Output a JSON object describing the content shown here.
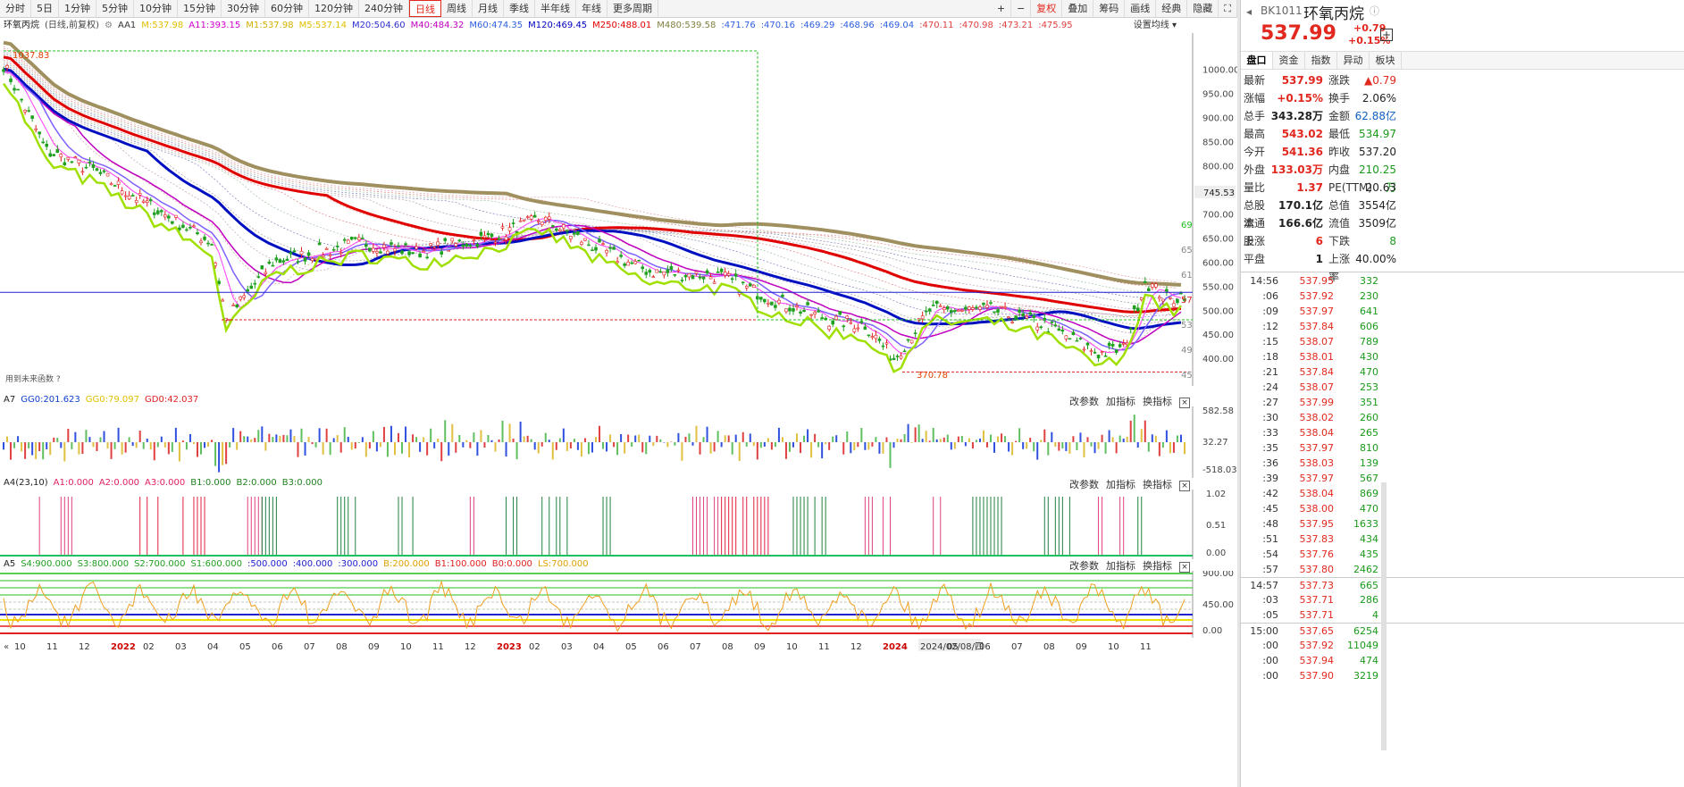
{
  "periods": [
    "分时",
    "5日",
    "1分钟",
    "5分钟",
    "10分钟",
    "15分钟",
    "30分钟",
    "60分钟",
    "120分钟",
    "240分钟",
    "日线",
    "周线",
    "月线",
    "季线",
    "半年线",
    "年线",
    "更多周期"
  ],
  "active_period": "日线",
  "tools": [
    "+",
    "−",
    "复权",
    "叠加",
    "筹码",
    "画线",
    "经典",
    "隐藏"
  ],
  "legend": {
    "name": "环氧丙烷",
    "mode": "(日线,前复权)",
    "items": [
      "AA1",
      "M:537.98",
      "A11:393.15",
      "M1:537.98",
      "M5:537.14",
      "M20:504.60",
      "M40:484.32",
      "M60:474.35",
      "M120:469.45",
      "M250:488.01",
      "M480:539.58",
      ":471.76",
      ":470.16",
      ":469.29",
      ":468.96",
      ":469.04",
      ":470.11",
      ":470.98",
      ":473.21",
      ":475.95"
    ],
    "settings": "设置均线"
  },
  "legend_colors": [
    "#333",
    "#e0c000",
    "#d000d0",
    "#d0b000",
    "#e0c000",
    "#3030d0",
    "#c000c0",
    "#3060e0",
    "#0000c0",
    "#e00000",
    "#808040",
    "#3060e0",
    "#3060e0",
    "#3060e0",
    "#3060e0",
    "#3060e0",
    "#e04040",
    "#e04040",
    "#e04040",
    "#e04040"
  ],
  "main": {
    "price_axis": [
      "1000.00",
      "950.00",
      "900.00",
      "850.00",
      "800.00",
      "750.00",
      "700.00",
      "650.00",
      "600.00",
      "550.00",
      "500.00",
      "450.00",
      "400.00"
    ],
    "current_price_label": "745.53",
    "high_label": "1037.83",
    "low_label": "370.78",
    "future_note": "用到未来函数",
    "future_q": "?",
    "right_marks": [
      "69",
      "65",
      "61",
      "57",
      "53",
      "49",
      "45",
      "41",
      "37"
    ]
  },
  "a7": {
    "title": "A7",
    "items": [
      "GG0:201.623",
      "GG0:79.097",
      "GD0:42.037"
    ],
    "axis": [
      "582.58",
      "32.27",
      "-518.03"
    ]
  },
  "a4": {
    "title": "A4(23,10)",
    "items": [
      "A1:0.000",
      "A2:0.000",
      "A3:0.000",
      "B1:0.000",
      "B2:0.000",
      "B3:0.000"
    ],
    "axis": [
      "1.02",
      "0.51",
      "0.00"
    ]
  },
  "a5": {
    "title": "A5",
    "items": [
      "S4:900.000",
      "S3:800.000",
      "S2:700.000",
      "S1:600.000",
      ":500.000",
      ":400.000",
      ":300.000",
      "B:200.000",
      "B1:100.000",
      "B0:0.000",
      "LS:700.000"
    ],
    "axis": [
      "900.00",
      "450.00",
      "0.00"
    ]
  },
  "pane_buttons": [
    "改参数",
    "加指标",
    "换指标"
  ],
  "x_axis": [
    "10",
    "11",
    "12",
    "2022",
    "02",
    "03",
    "04",
    "05",
    "06",
    "07",
    "08",
    "09",
    "10",
    "11",
    "12",
    "2023",
    "02",
    "03",
    "04",
    "05",
    "06",
    "07",
    "08",
    "09",
    "10",
    "11",
    "12",
    "2024",
    "2024/02/08/四",
    "05",
    "06",
    "07",
    "08",
    "09",
    "10",
    "11"
  ],
  "quote": {
    "code": "BK1011",
    "name": "环氧丙烷",
    "price": "537.99",
    "change": "+0.79",
    "pct": "+0.15%",
    "tabs": [
      "盘口",
      "资金",
      "指数",
      "异动",
      "板块"
    ],
    "rows": [
      [
        "最新",
        "537.99",
        "涨跌",
        "▲0.79"
      ],
      [
        "涨幅",
        "+0.15%",
        "换手",
        "2.06%"
      ],
      [
        "总手",
        "343.28万",
        "金额",
        "62.88亿"
      ],
      [
        "最高",
        "543.02",
        "最低",
        "534.97"
      ],
      [
        "今开",
        "541.36",
        "昨收",
        "537.20"
      ],
      [
        "外盘",
        "133.03万",
        "内盘",
        "210.25万"
      ],
      [
        "量比",
        "1.37",
        "PE(TTM)",
        "20.63"
      ],
      [
        "总股本",
        "170.1亿",
        "总值",
        "3554亿"
      ],
      [
        "流通股",
        "166.6亿",
        "流值",
        "3509亿"
      ],
      [
        "上涨",
        "6",
        "下跌",
        "8"
      ],
      [
        "平盘",
        "1",
        "上涨率",
        "40.00%"
      ]
    ]
  },
  "ticks": [
    [
      "14:56",
      "537.95",
      "332"
    ],
    [
      ":06",
      "537.92",
      "230"
    ],
    [
      ":09",
      "537.97",
      "641"
    ],
    [
      ":12",
      "537.84",
      "606"
    ],
    [
      ":15",
      "538.07",
      "789"
    ],
    [
      ":18",
      "538.01",
      "430"
    ],
    [
      ":21",
      "537.84",
      "470"
    ],
    [
      ":24",
      "538.07",
      "253"
    ],
    [
      ":27",
      "537.99",
      "351"
    ],
    [
      ":30",
      "538.02",
      "260"
    ],
    [
      ":33",
      "538.04",
      "265"
    ],
    [
      ":35",
      "537.97",
      "810"
    ],
    [
      ":36",
      "538.03",
      "139"
    ],
    [
      ":39",
      "537.97",
      "567"
    ],
    [
      ":42",
      "538.04",
      "869"
    ],
    [
      ":45",
      "538.00",
      "470"
    ],
    [
      ":48",
      "537.95",
      "1633"
    ],
    [
      ":51",
      "537.83",
      "434"
    ],
    [
      ":54",
      "537.76",
      "435"
    ],
    [
      ":57",
      "537.80",
      "2462"
    ],
    [
      "14:57",
      "537.73",
      "665"
    ],
    [
      ":03",
      "537.71",
      "286"
    ],
    [
      ":05",
      "537.71",
      "4"
    ],
    [
      "15:00",
      "537.65",
      "6254"
    ],
    [
      ":00",
      "537.92",
      "11049"
    ],
    [
      ":00",
      "537.94",
      "474"
    ],
    [
      ":00",
      "537.90",
      "3219"
    ]
  ]
}
